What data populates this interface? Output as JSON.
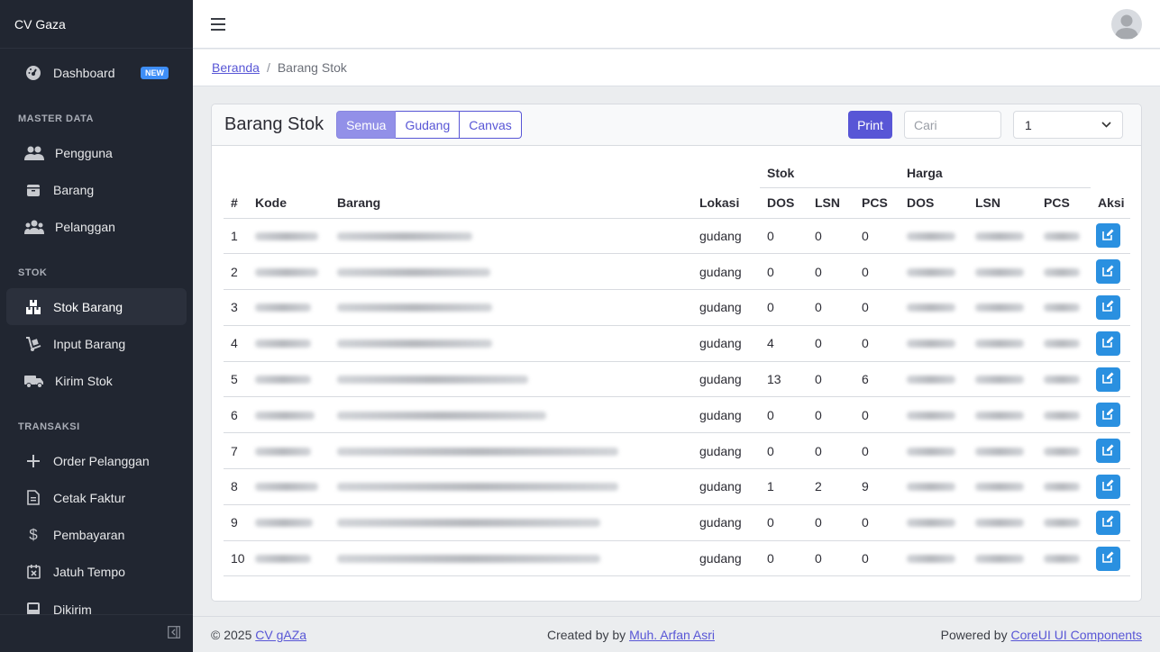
{
  "brand": "CV Gaza",
  "sidebar": {
    "items": [
      {
        "label": "Dashboard",
        "badge": "NEW"
      },
      {
        "section": "MASTER DATA"
      },
      {
        "label": "Pengguna"
      },
      {
        "label": "Barang"
      },
      {
        "label": "Pelanggan"
      },
      {
        "section": "STOK"
      },
      {
        "label": "Stok Barang"
      },
      {
        "label": "Input Barang"
      },
      {
        "label": "Kirim Stok"
      },
      {
        "section": "TRANSAKSI"
      },
      {
        "label": "Order Pelanggan"
      },
      {
        "label": "Cetak Faktur"
      },
      {
        "label": "Pembayaran"
      },
      {
        "label": "Jatuh Tempo"
      },
      {
        "label": "Dikirim"
      }
    ]
  },
  "breadcrumb": {
    "home": "Beranda",
    "current": "Barang Stok"
  },
  "card": {
    "title": "Barang Stok",
    "filters": [
      "Semua",
      "Gudang",
      "Canvas"
    ],
    "print_label": "Print",
    "search_placeholder": "Cari",
    "page_select": "1"
  },
  "table": {
    "group_headers": {
      "stok": "Stok",
      "harga": "Harga"
    },
    "headers": [
      "#",
      "Kode",
      "Barang",
      "Lokasi",
      "DOS",
      "LSN",
      "PCS",
      "DOS",
      "LSN",
      "PCS",
      "Aksi"
    ],
    "rows": [
      {
        "no": "1",
        "lokasi": "gudang",
        "dos": "0",
        "lsn": "0",
        "pcs": "0"
      },
      {
        "no": "2",
        "lokasi": "gudang",
        "dos": "0",
        "lsn": "0",
        "pcs": "0"
      },
      {
        "no": "3",
        "lokasi": "gudang",
        "dos": "0",
        "lsn": "0",
        "pcs": "0"
      },
      {
        "no": "4",
        "lokasi": "gudang",
        "dos": "4",
        "lsn": "0",
        "pcs": "0"
      },
      {
        "no": "5",
        "lokasi": "gudang",
        "dos": "13",
        "lsn": "0",
        "pcs": "6"
      },
      {
        "no": "6",
        "lokasi": "gudang",
        "dos": "0",
        "lsn": "0",
        "pcs": "0"
      },
      {
        "no": "7",
        "lokasi": "gudang",
        "dos": "0",
        "lsn": "0",
        "pcs": "0"
      },
      {
        "no": "8",
        "lokasi": "gudang",
        "dos": "1",
        "lsn": "2",
        "pcs": "9"
      },
      {
        "no": "9",
        "lokasi": "gudang",
        "dos": "0",
        "lsn": "0",
        "pcs": "0"
      },
      {
        "no": "10",
        "lokasi": "gudang",
        "dos": "0",
        "lsn": "0",
        "pcs": "0"
      }
    ]
  },
  "footer": {
    "copyright": "© 2025",
    "company": "CV gAZa",
    "created_by": "Created by by",
    "author": "Muh. Arfan Asri",
    "powered_by": "Powered by",
    "powered_link": "CoreUI UI Components"
  },
  "icons": {
    "dashboard": "speedometer-icon",
    "pengguna": "people-icon",
    "barang": "box-icon",
    "pelanggan": "group-icon",
    "stok_barang": "boxes-icon",
    "input_barang": "dolly-icon",
    "kirim_stok": "truck-icon",
    "order": "plus-icon",
    "faktur": "file-icon",
    "pembayaran": "dollar-icon",
    "jatuh_tempo": "calendar-x-icon",
    "dikirim": "inbox-icon",
    "edit": "edit-icon"
  },
  "colors": {
    "sidebar": "#212631",
    "primary": "#5856d6",
    "edit_button": "#2a90e0"
  }
}
